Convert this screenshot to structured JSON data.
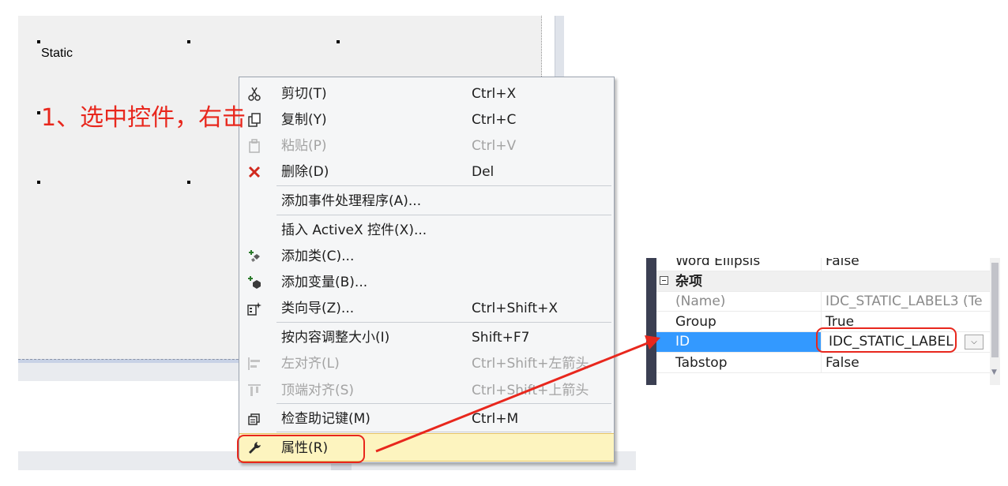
{
  "designer": {
    "static_text": "Static"
  },
  "annotation": {
    "step1": "1、选中控件，右击",
    "color": "#e8271d"
  },
  "context_menu": {
    "items": [
      {
        "label": "剪切(T)",
        "shortcut": "Ctrl+X",
        "icon": "scissors-icon",
        "disabled": false
      },
      {
        "label": "复制(Y)",
        "shortcut": "Ctrl+C",
        "icon": "copy-icon",
        "disabled": false
      },
      {
        "label": "粘贴(P)",
        "shortcut": "Ctrl+V",
        "icon": "paste-icon",
        "disabled": true
      },
      {
        "label": "删除(D)",
        "shortcut": "Del",
        "icon": "delete-icon",
        "disabled": false
      },
      {
        "label": "添加事件处理程序(A)...",
        "shortcut": "",
        "icon": "",
        "disabled": false
      },
      {
        "label": "插入 ActiveX 控件(X)...",
        "shortcut": "",
        "icon": "",
        "disabled": false
      },
      {
        "label": "添加类(C)...",
        "shortcut": "",
        "icon": "add-class-icon",
        "disabled": false
      },
      {
        "label": "添加变量(B)...",
        "shortcut": "",
        "icon": "add-variable-icon",
        "disabled": false
      },
      {
        "label": "类向导(Z)...",
        "shortcut": "Ctrl+Shift+X",
        "icon": "class-wizard-icon",
        "disabled": false
      },
      {
        "label": "按内容调整大小(I)",
        "shortcut": "Shift+F7",
        "icon": "",
        "disabled": false
      },
      {
        "label": "左对齐(L)",
        "shortcut": "Ctrl+Shift+左箭头",
        "icon": "align-left-icon",
        "disabled": true
      },
      {
        "label": "顶端对齐(S)",
        "shortcut": "Ctrl+Shift+上箭头",
        "icon": "align-top-icon",
        "disabled": true
      },
      {
        "label": "检查助记键(M)",
        "shortcut": "Ctrl+M",
        "icon": "check-mnemonics-icon",
        "disabled": false
      },
      {
        "label": "属性(R)",
        "shortcut": "",
        "icon": "wrench-icon",
        "disabled": false,
        "highlighted": true
      }
    ]
  },
  "property_grid": {
    "rows": [
      {
        "name": "Word Ellipsis",
        "value": "False"
      },
      {
        "category": "杂项"
      },
      {
        "name": "(Name)",
        "value": "IDC_STATIC_LABEL3 (Te",
        "readonly": true
      },
      {
        "name": "Group",
        "value": "True"
      },
      {
        "name": "ID",
        "value": "IDC_STATIC_LABEL",
        "selected": true
      },
      {
        "name": "Tabstop",
        "value": "False"
      }
    ]
  },
  "colors": {
    "menu_highlight": "#fdf4bf",
    "selection_blue": "#3399ff",
    "annotation_red": "#e8271d"
  }
}
